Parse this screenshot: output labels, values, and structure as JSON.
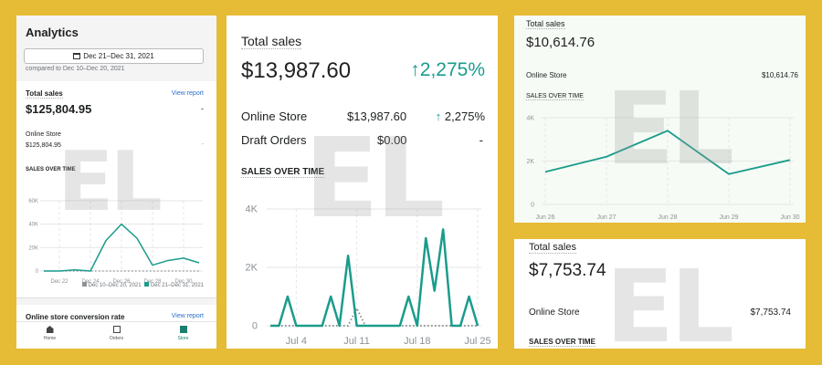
{
  "colors": {
    "background": "#E6BB35",
    "accent": "#1A9C8C",
    "comparison": "#8C9196",
    "link": "#2C6ECB"
  },
  "watermark": "EL",
  "panel1": {
    "title": "Analytics",
    "date_range": "Dec 21–Dec 31, 2021",
    "compared_to": "compared to Dec 10–Dec 20, 2021",
    "total_sales_label": "Total sales",
    "view_report": "View report",
    "total_sales_value": "$125,804.95",
    "total_change": "-",
    "channel_label": "Online Store",
    "channel_value": "$125,804.95",
    "channel_change": "-",
    "chart_title": "SALES OVER TIME",
    "conversion_label": "Online store conversion rate",
    "conversion_view_report": "View report",
    "nav": [
      {
        "label": "Home",
        "icon": "home-icon"
      },
      {
        "label": "Orders",
        "icon": "orders-icon"
      },
      {
        "label": "Store",
        "icon": "store-icon",
        "active": true
      }
    ]
  },
  "panel2": {
    "title": "Total sales",
    "value": "$13,987.60",
    "change": "2,275%",
    "rows": [
      {
        "label": "Online Store",
        "value": "$13,987.60",
        "change": "2,275%",
        "up": true
      },
      {
        "label": "Draft Orders",
        "value": "$0.00",
        "change": "-",
        "up": false
      }
    ],
    "chart_title": "SALES OVER TIME"
  },
  "panel3": {
    "title": "Total sales",
    "value": "$10,614.76",
    "channel_label": "Online Store",
    "channel_value": "$10,614.76",
    "chart_title": "SALES OVER TIME"
  },
  "panel4": {
    "title": "Total sales",
    "value": "$7,753.74",
    "channel_label": "Online Store",
    "channel_value": "$7,753.74",
    "chart_title": "SALES OVER TIME"
  },
  "chart_data": [
    {
      "type": "line",
      "ylim": [
        0,
        60000
      ],
      "yticks": [
        "0",
        "20K",
        "40K",
        "60K"
      ],
      "x": [
        "Dec 21",
        "Dec 22",
        "Dec 23",
        "Dec 24",
        "Dec 25",
        "Dec 26",
        "Dec 27",
        "Dec 28",
        "Dec 29",
        "Dec 30",
        "Dec 31"
      ],
      "xticks": [
        "Dec 22",
        "Dec 24",
        "Dec 26",
        "Dec 28",
        "Dec 30"
      ],
      "legend": "bottom-right",
      "series": [
        {
          "name": "Dec 10–Dec 20, 2021",
          "color": "#8C9196",
          "style": "dotted",
          "values": [
            0,
            0,
            0,
            0,
            0,
            0,
            0,
            0,
            0,
            0,
            0
          ]
        },
        {
          "name": "Dec 21–Dec 31, 2021",
          "color": "#1A9C8C",
          "values": [
            0,
            0,
            1000,
            0,
            26000,
            40000,
            28000,
            5000,
            9000,
            11000,
            7000
          ]
        }
      ]
    },
    {
      "type": "line",
      "ylim": [
        0,
        4000
      ],
      "yticks": [
        "0",
        "2K",
        "4K"
      ],
      "x": [
        "Jul 1",
        "Jul 2",
        "Jul 3",
        "Jul 4",
        "Jul 5",
        "Jul 6",
        "Jul 7",
        "Jul 8",
        "Jul 9",
        "Jul 10",
        "Jul 11",
        "Jul 12",
        "Jul 13",
        "Jul 14",
        "Jul 15",
        "Jul 16",
        "Jul 17",
        "Jul 18",
        "Jul 19",
        "Jul 20",
        "Jul 21",
        "Jul 22",
        "Jul 23",
        "Jul 24",
        "Jul 25"
      ],
      "xticks": [
        "Jul 4",
        "Jul 11",
        "Jul 18",
        "Jul 25"
      ],
      "series": [
        {
          "color": "#8C9196",
          "style": "dotted",
          "values": [
            0,
            0,
            0,
            0,
            0,
            0,
            0,
            0,
            0,
            0,
            600,
            0,
            0,
            0,
            0,
            0,
            0,
            0,
            0,
            0,
            0,
            0,
            0,
            0,
            0
          ]
        },
        {
          "color": "#1A9C8C",
          "values": [
            0,
            0,
            1000,
            0,
            0,
            0,
            0,
            1000,
            0,
            2400,
            0,
            0,
            0,
            0,
            0,
            0,
            1000,
            0,
            3000,
            1200,
            3300,
            0,
            0,
            1000,
            0
          ]
        }
      ]
    },
    {
      "type": "line",
      "ylim": [
        0,
        4000
      ],
      "yticks": [
        "0",
        "2K",
        "4K"
      ],
      "x": [
        "Jun 26",
        "Jun 27",
        "Jun 28",
        "Jun 29",
        "Jun 30"
      ],
      "xticks": [
        "Jun 26",
        "Jun 27",
        "Jun 28",
        "Jun 29",
        "Jun 30"
      ],
      "series": [
        {
          "color": "#1A9C8C",
          "values": [
            1500,
            2200,
            3400,
            1400,
            2050
          ]
        }
      ]
    }
  ]
}
